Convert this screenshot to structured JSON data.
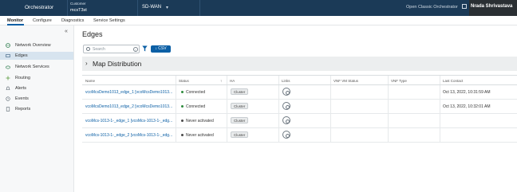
{
  "header": {
    "brand": "Orchestrator",
    "customer_label": "Customer",
    "customer_value": "mcsT3st",
    "product": "SD-WAN",
    "open_classic": "Open Classic Orchestrator",
    "user": "Nradа Shrivastava"
  },
  "tabs": [
    "Monitor",
    "Configure",
    "Diagnostics",
    "Service Settings"
  ],
  "sidebar": {
    "items": [
      {
        "label": "Network Overview",
        "icon": "globe-icon"
      },
      {
        "label": "Edges",
        "icon": "edge-device-icon"
      },
      {
        "label": "Network Services",
        "icon": "cloud-icon"
      },
      {
        "label": "Routing",
        "icon": "routing-icon"
      },
      {
        "label": "Alerts",
        "icon": "bell-icon"
      },
      {
        "label": "Events",
        "icon": "history-icon"
      },
      {
        "label": "Reports",
        "icon": "report-icon"
      }
    ]
  },
  "main": {
    "title": "Edges",
    "search_placeholder": "Search",
    "csv_label": "↓ CSV",
    "map_distribution": "Map Distribution"
  },
  "table": {
    "columns": [
      "Name",
      "Status",
      "HA",
      "Links",
      "VNF VM Status",
      "VNF Type",
      "Last Contact"
    ],
    "rows": [
      {
        "name": "vcoMcsDemo1013_edge_1 [vcoMcsDemo1013...",
        "status": "Connected",
        "status_color": "#2e8b3d",
        "ha": "Cluster",
        "last_contact": "Oct 13, 2022, 10:31:59 AM"
      },
      {
        "name": "vcoMcsDemo1013_edge_2 [vcoMcsDemo1013...",
        "status": "Connected",
        "status_color": "#2e8b3d",
        "ha": "Cluster",
        "last_contact": "Oct 13, 2022, 10:32:01 AM"
      },
      {
        "name": "vcoMcs-1013-1-_edge_1 [vcoMcs-1013-1-_edg...",
        "status": "Never activated",
        "status_color": "#4a4a4a",
        "ha": "Cluster",
        "last_contact": ""
      },
      {
        "name": "vcoMcs-1013-1-_edge_2 [vcoMcs-1013-1-_edg...",
        "status": "Never activated",
        "status_color": "#4a4a4a",
        "ha": "Cluster",
        "last_contact": ""
      }
    ]
  },
  "colors": {
    "header_bg": "#1b3a57",
    "accent": "#0b5fa5",
    "connected": "#2e8b3d"
  }
}
